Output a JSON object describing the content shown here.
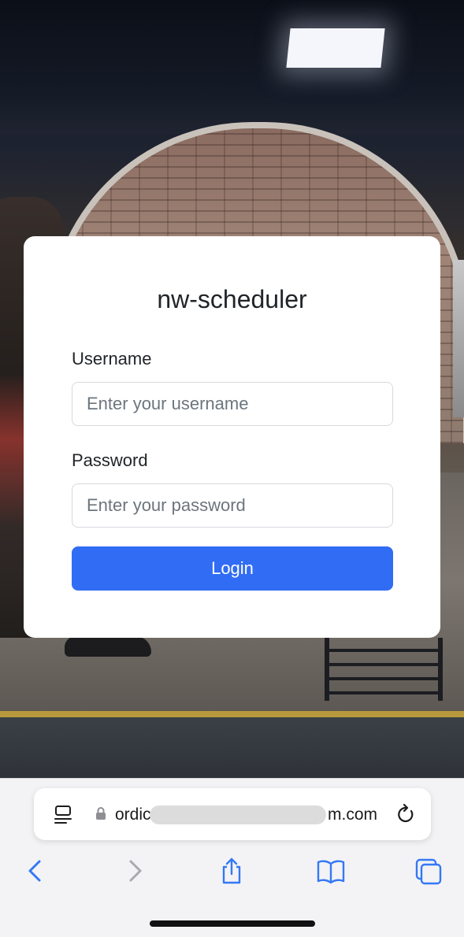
{
  "app": {
    "title": "nw-scheduler"
  },
  "form": {
    "username_label": "Username",
    "username_placeholder": "Enter your username",
    "username_value": "",
    "password_label": "Password",
    "password_placeholder": "Enter your password",
    "password_value": "",
    "login_label": "Login"
  },
  "browser": {
    "url_visible_start": "ordic",
    "url_visible_end": "m.com",
    "icons": [
      "tab-overview-icon",
      "lock-icon",
      "reload-icon",
      "back-icon",
      "forward-icon",
      "share-icon",
      "bookmarks-icon",
      "tabs-icon"
    ]
  },
  "colors": {
    "accent": "#316cf4",
    "card_background": "#ffffff",
    "text": "#212529",
    "toolbar_blue": "#3478f6",
    "toolbar_disabled": "#a9a9ae"
  }
}
